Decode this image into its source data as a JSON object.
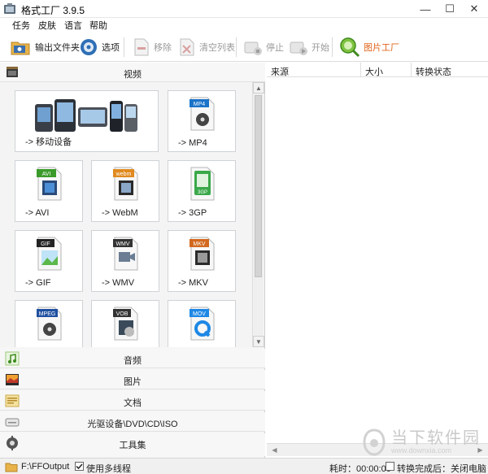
{
  "window": {
    "title": "格式工厂 3.9.5",
    "minimize_glyph": "—",
    "maximize_glyph": "☐",
    "close_glyph": "✕"
  },
  "menu": [
    "任务",
    "皮肤",
    "语言",
    "帮助"
  ],
  "toolbar": {
    "output_folder": "输出文件夹",
    "options": "选项",
    "remove": "移除",
    "clear_list": "清空列表",
    "stop": "停止",
    "start": "开始",
    "picture_factory": "图片工厂"
  },
  "categories": {
    "video": "视频",
    "audio": "音频",
    "picture": "图片",
    "document": "文档",
    "rom": "光驱设备\\DVD\\CD\\ISO",
    "tools": "工具集"
  },
  "tiles": [
    {
      "label": "-> 移动设备",
      "icon": "mobile-devices-icon"
    },
    {
      "label": "-> MP4",
      "icon": "mp4-file-icon",
      "badge": "MP4",
      "badge_color": "#1a73c9"
    },
    {
      "label": "-> AVI",
      "icon": "avi-file-icon",
      "badge": "AVI",
      "badge_color": "#3a9b2a"
    },
    {
      "label": "-> WebM",
      "icon": "webm-file-icon",
      "badge": "webm",
      "badge_color": "#e08a1f"
    },
    {
      "label": "-> 3GP",
      "icon": "3gp-file-icon",
      "badge": "3GP",
      "badge_color": "#3aa84a"
    },
    {
      "label": "-> GIF",
      "icon": "gif-file-icon",
      "badge": "GIF",
      "badge_color": "#222222"
    },
    {
      "label": "-> WMV",
      "icon": "wmv-file-icon",
      "badge": "WMV",
      "badge_color": "#333333"
    },
    {
      "label": "-> MKV",
      "icon": "mkv-file-icon",
      "badge": "MKV",
      "badge_color": "#d2691e"
    },
    {
      "label": "",
      "icon": "mpeg-file-icon",
      "badge": "MPEG",
      "badge_color": "#2050a0"
    },
    {
      "label": "",
      "icon": "vob-file-icon",
      "badge": "VOB",
      "badge_color": "#333333"
    },
    {
      "label": "",
      "icon": "mov-file-icon",
      "badge": "MOV",
      "badge_color": "#1e88e5"
    }
  ],
  "file_list": {
    "col_source": "来源",
    "col_size": "大小",
    "col_status": "转换状态"
  },
  "status": {
    "output_path": "F:\\FFOutput",
    "multithread": "使用多线程",
    "elapsed": "耗时：00:00:00",
    "after_convert": "转换完成后：关闭电脑"
  },
  "watermark": {
    "main": "当下软件园",
    "sub": "www.downxia.com"
  },
  "colors": {
    "accent": "#1a73c9",
    "picture_factory": "#e0641a"
  }
}
